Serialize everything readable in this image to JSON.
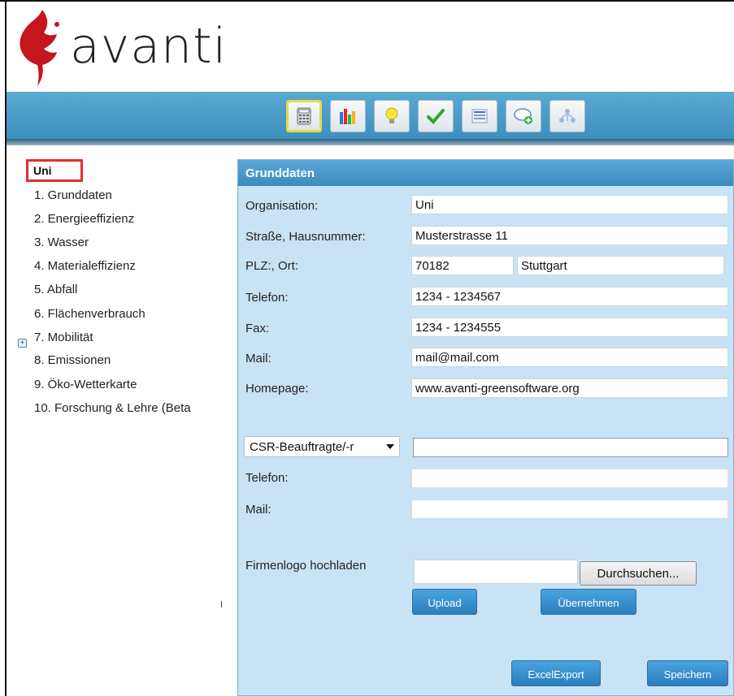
{
  "app": {
    "brand": "avanti"
  },
  "toolbar": {
    "buttons": [
      {
        "icon": "calculator-icon"
      },
      {
        "icon": "bar-chart-icon"
      },
      {
        "icon": "lightbulb-icon"
      },
      {
        "icon": "checkmark-icon"
      },
      {
        "icon": "list-icon"
      },
      {
        "icon": "comment-add-icon"
      },
      {
        "icon": "network-icon"
      }
    ]
  },
  "sidebar": {
    "root": "Uni",
    "items": [
      "1. Grunddaten",
      "2. Energieeffizienz",
      "3. Wasser",
      "4. Materialeffizienz",
      "5. Abfall",
      "6. Flächenverbrauch",
      "7. Mobilität",
      "8. Emissionen",
      "9. Öko-Wetterkarte",
      "10. Forschung & Lehre (Beta"
    ]
  },
  "panel": {
    "title": "Grunddaten",
    "organisation_label": "Organisation:",
    "organisation_value": "Uni",
    "street_label": "Straße, Hausnummer:",
    "street_value": "Musterstrasse 11",
    "plz_label": "PLZ:, Ort:",
    "plz_value": "70182",
    "ort_value": "Stuttgart",
    "telefon_label": "Telefon:",
    "telefon_value": "1234 - 1234567",
    "fax_label": "Fax:",
    "fax_value": "1234 - 1234555",
    "mail_label": "Mail:",
    "mail_value": "mail@mail.com",
    "homepage_label": "Homepage:",
    "homepage_value": "www.avanti-greensoftware.org",
    "csr_select": "CSR-Beauftragte/-r",
    "csr_value": "",
    "csr_telefon_label": "Telefon:",
    "csr_telefon_value": "",
    "csr_mail_label": "Mail:",
    "csr_mail_value": "",
    "logo_label": "Firmenlogo hochladen",
    "browse_button": "Durchsuchen...",
    "upload_button": "Upload",
    "apply_button": "Übernehmen",
    "excel_button": "ExcelExport",
    "save_button": "Speichern"
  },
  "colors": {
    "toolbar": "#4a9ccb",
    "panel_bg": "#c8e3f6",
    "panel_header": "#4a9bcc",
    "button_blue": "#3a90cc",
    "highlight_red": "#e03030",
    "logo_red": "#c4161c"
  }
}
